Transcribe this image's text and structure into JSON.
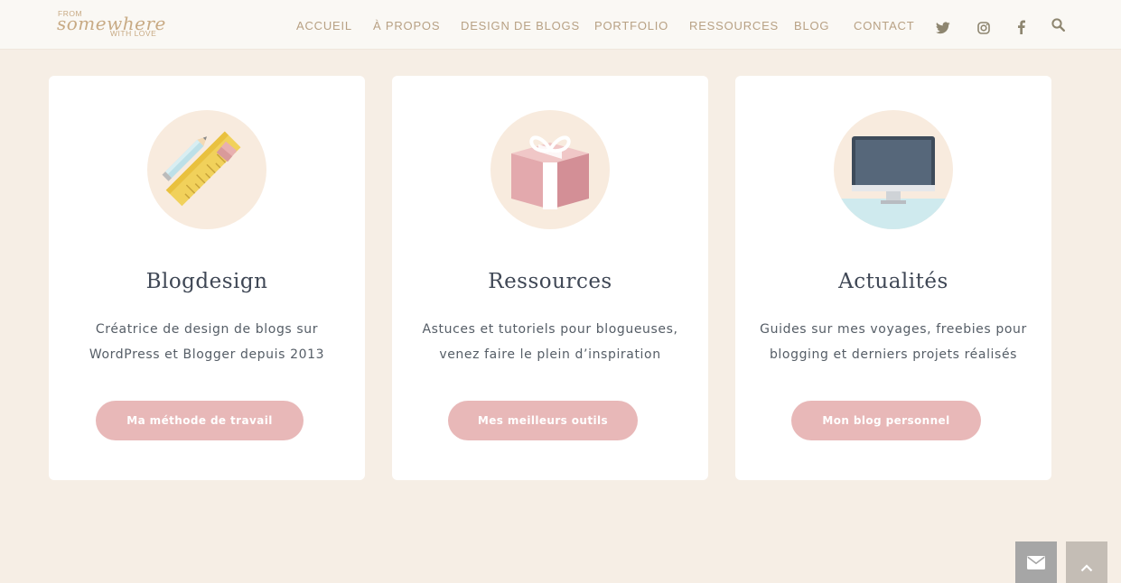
{
  "logo": {
    "line1": "FROM",
    "line2": "somewhere",
    "line3": "WITH LOVE"
  },
  "nav": {
    "items": [
      {
        "label": "ACCUEIL"
      },
      {
        "label": "À PROPOS"
      },
      {
        "label": "DESIGN DE BLOGS"
      },
      {
        "label": "PORTFOLIO"
      },
      {
        "label": "RESSOURCES"
      },
      {
        "label": "BLOG"
      },
      {
        "label": "CONTACT"
      }
    ],
    "social_icons": [
      "twitter-icon",
      "instagram-icon",
      "facebook-icon",
      "search-icon"
    ]
  },
  "cards": [
    {
      "icon": "ruler-pencil-icon",
      "title": "Blogdesign",
      "desc_line1": "Créatrice de design de blogs sur",
      "desc_line2": "WordPress et Blogger depuis 2013",
      "button": "Ma méthode de travail"
    },
    {
      "icon": "gift-icon",
      "title": "Ressources",
      "desc_line1": "Astuces et tutoriels pour blogueuses,",
      "desc_line2": "venez faire le plein d’inspiration",
      "button": "Mes meilleurs outils"
    },
    {
      "icon": "monitor-icon",
      "title": "Actualités",
      "desc_line1": "Guides sur mes voyages, freebies pour",
      "desc_line2": "blogging et derniers projets réalisés",
      "button": "Mon blog personnel"
    }
  ],
  "fixed_buttons": [
    "envelope-icon",
    "chevron-up-icon"
  ],
  "colors": {
    "page_bg": "#f6eee5",
    "header_bg": "#faf8f4",
    "nav_text": "#b8a184",
    "button_bg": "#e8b8b8",
    "title_text": "#3f4755",
    "fixed_button_bg": "#a6a6a6"
  }
}
